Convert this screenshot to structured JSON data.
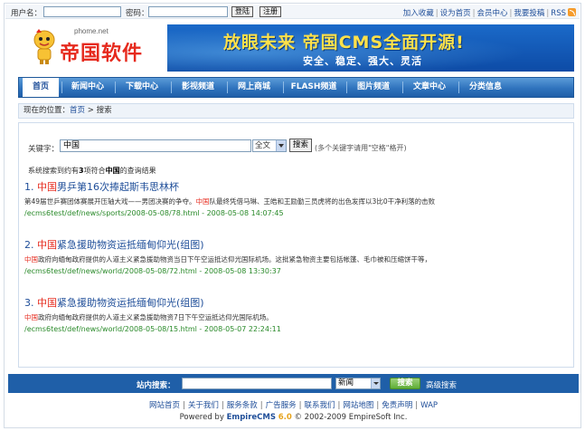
{
  "topbar": {
    "username_label": "用户名：",
    "password_label": "密码：",
    "login_button": "登陆",
    "register_button": "注册",
    "links": [
      "加入收藏",
      "设为首页",
      "会员中心",
      "我要投稿",
      "RSS"
    ]
  },
  "logo": {
    "url_text": "phome.net",
    "name": "帝国软件"
  },
  "banner": {
    "title": "放眼未来 帝国CMS全面开源!",
    "subtitle": "安全、稳定、强大、灵活"
  },
  "nav": {
    "items": [
      "首页",
      "新闻中心",
      "下载中心",
      "影视频道",
      "网上商城",
      "FLASH频道",
      "图片频道",
      "文章中心",
      "分类信息"
    ],
    "active_index": 0
  },
  "breadcrumb": {
    "prefix": "现在的位置：",
    "home": "首页",
    "separator": ">",
    "current": "搜索"
  },
  "search": {
    "label": "关键字：",
    "value": "中国",
    "scope": "全文",
    "button": "搜索",
    "hint": "(多个关键字请用\"空格\"格开)"
  },
  "summary": {
    "prefix": "系统搜索到约有",
    "count": "3",
    "middle": "项符合",
    "keyword": "中国",
    "suffix": "的查询结果"
  },
  "results": [
    {
      "index": "1.",
      "highlight": "中国",
      "title_rest": "男乒第16次捧起斯韦思林杯",
      "desc_pre": "第49届世乒赛团体赛展开压轴大戏——男团决赛的争夺。",
      "desc_hl": "中国",
      "desc_post": "队最终凭借马琳、王皓和王励勤三员虎将的出色发挥以3比0干净利落的击败",
      "url": "/ecms6test/def/news/sports/2008-05-08/78.html - 2008-05-08 14:07:45"
    },
    {
      "index": "2.",
      "highlight": "中国",
      "title_rest": "紧急援助物资运抵缅甸仰光(组图)",
      "desc_pre": "",
      "desc_hl": "中国",
      "desc_post": "政府向缅甸政府提供的人道主义紧急援助物资当日下午空运抵达仰光国际机场。这批紧急物资主要包括帐篷、毛巾被和压缩饼干等，",
      "url": "/ecms6test/def/news/world/2008-05-08/72.html - 2008-05-08 13:30:37"
    },
    {
      "index": "3.",
      "highlight": "中国",
      "title_rest": "紧急援助物资运抵缅甸仰光(组图)",
      "desc_pre": "",
      "desc_hl": "中国",
      "desc_post": "政府向缅甸政府提供的人道主义紧急援助物资7日下午空运抵达仰光国际机场。",
      "url": "/ecms6test/def/news/world/2008-05-08/15.html - 2008-05-07 22:24:11"
    }
  ],
  "footer_search": {
    "label": "站内搜索：",
    "scope": "新闻",
    "button": "搜索",
    "advanced": "高级搜索"
  },
  "footer": {
    "links": [
      "网站首页",
      "关于我们",
      "服务条款",
      "广告服务",
      "联系我们",
      "网站地图",
      "免责声明",
      "WAP"
    ],
    "powered_by": "Powered by",
    "brand": "EmpireCMS",
    "version": "6.0",
    "copyright": "© 2002-2009 EmpireSoft Inc."
  },
  "colors": {
    "nav_blue": "#2f73bd",
    "highlight_red": "#e62a1d",
    "url_green": "#2a8a2a",
    "link_blue": "#1f4e99"
  }
}
